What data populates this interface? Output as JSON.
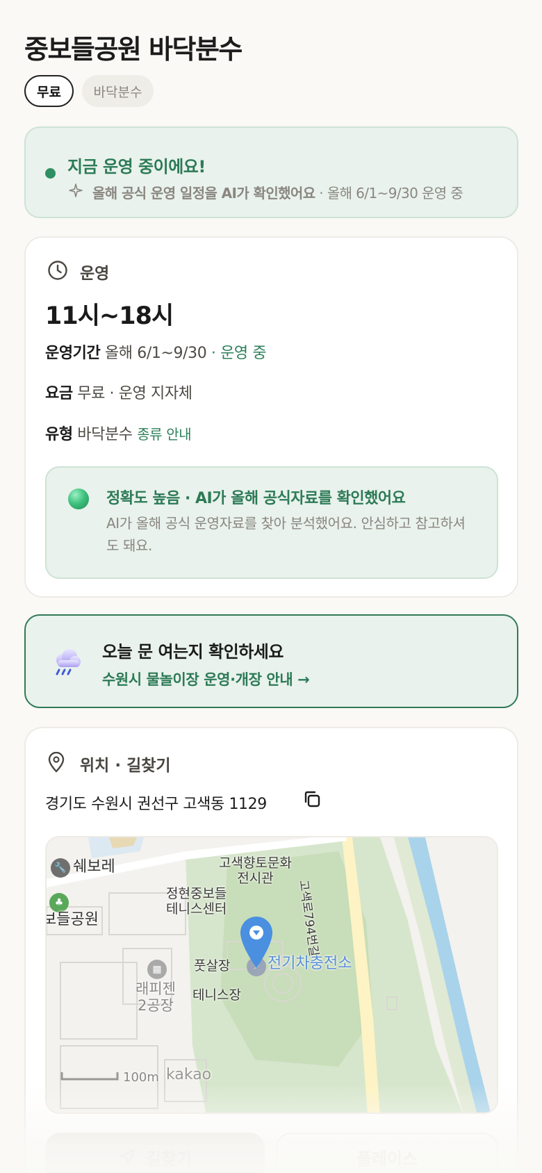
{
  "page": {
    "title": "중보들공원 바닥분수"
  },
  "chips": [
    {
      "label": "무료"
    },
    {
      "label": "바닥분수"
    }
  ],
  "status": {
    "title": "지금 운영 중이에요!",
    "sub_bold": "올해 공식 운영 일정을 AI가 확인했어요",
    "sub_rest": " · 올해 6/1~9/30 운영 중"
  },
  "operation": {
    "section_label": "운영",
    "hours": "11시~18시",
    "period_key": "운영기간",
    "period_value": " 올해 6/1~9/30",
    "period_status": " · 운영 중",
    "fee_key": "요금",
    "fee_value": " 무료 · 운영 지자체",
    "type_key": "유형",
    "type_value": " 바닥분수 ",
    "type_link": "종류 안내",
    "accuracy": {
      "title": "정확도 높음 · AI가 올해 공식자료를 확인했어요",
      "desc": "AI가 올해 공식 운영자료를 찾아 분석했어요. 안심하고 참고하셔도 돼요."
    }
  },
  "today": {
    "title": "오늘 문 여는지 확인하세요",
    "link": "수원시 물놀이장 운영·개장 안내 →"
  },
  "location": {
    "section_label": "위치 · 길찾기",
    "address": "경기도 수원시 권선구 고색동 1129",
    "map": {
      "labels": {
        "swebore": "쉐보레",
        "museum": "고색향토문화\n전시관",
        "tennis_center": "정현중보들\n테니스센터",
        "park": "보들공원",
        "futsal": "풋살장",
        "tennis": "테니스장",
        "ev": "전기차충전소",
        "factory": "래피젠\n2공장",
        "road": "고색로794번길",
        "scale": "100m",
        "brand": "kakao"
      }
    },
    "buttons": {
      "directions": "길찾기",
      "place": "플레이스"
    }
  },
  "colors": {
    "accent_green": "#2c7a56",
    "status_bg": "#e9f2ec",
    "pin_blue": "#4a8fe0"
  }
}
